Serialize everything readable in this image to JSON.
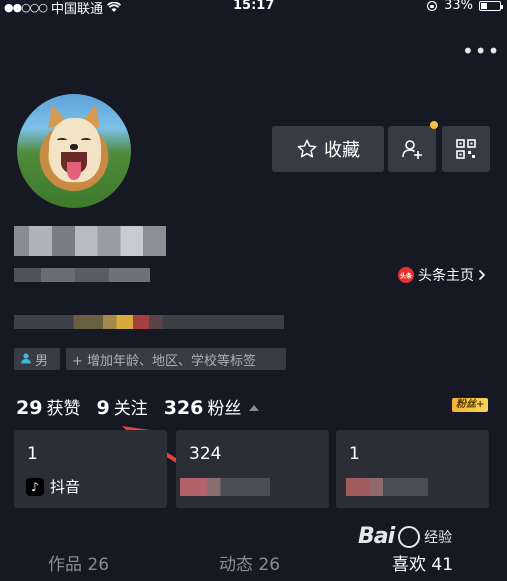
{
  "status_bar": {
    "signal": "●●○○○",
    "carrier": "中国联通",
    "time": "15:17",
    "battery": "33%",
    "battery_level": 0.33
  },
  "profile": {
    "collect_label": "收藏",
    "toutiao_label": "头条主页",
    "toutiao_icon_text": "头条",
    "gender_label": "男",
    "add_tags_label": "+ 增加年龄、地区、学校等标签"
  },
  "stats": {
    "likes_count": "29",
    "likes_label": "获赞",
    "following_count": "9",
    "following_label": "关注",
    "fans_count": "326",
    "fans_label": "粉丝",
    "fans_badge": "粉丝+"
  },
  "cards": [
    {
      "number": "1",
      "label": "抖音"
    },
    {
      "number": "324"
    },
    {
      "number": "1"
    }
  ],
  "tabs": [
    {
      "label": "作品 26"
    },
    {
      "label": "动态 26"
    },
    {
      "label": "喜欢 41"
    }
  ],
  "watermark": {
    "text": "Bai",
    "sub": "经验"
  },
  "colors": {
    "background": "#161823",
    "button_bg": "#393b44",
    "card_bg": "#2c2e37",
    "notify_dot": "#f5c33b",
    "arrow": "#e8413b"
  }
}
